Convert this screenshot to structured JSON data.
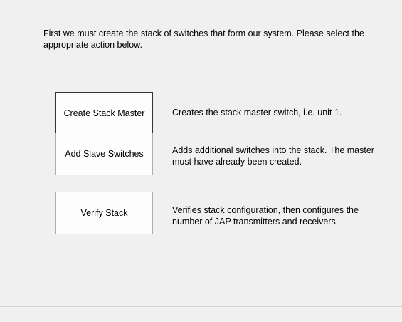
{
  "intro_text": "First we must create the stack of switches that form our system. Please select the appropriate action below.",
  "actions": [
    {
      "label": "Create Stack Master",
      "description": "Creates the stack master switch, i.e. unit 1."
    },
    {
      "label": "Add Slave Switches",
      "description": "Adds additional switches into the stack. The master must have already been created."
    },
    {
      "label": "Verify Stack",
      "description": "Verifies stack configuration, then configures the number of JAP transmitters and receivers."
    }
  ]
}
